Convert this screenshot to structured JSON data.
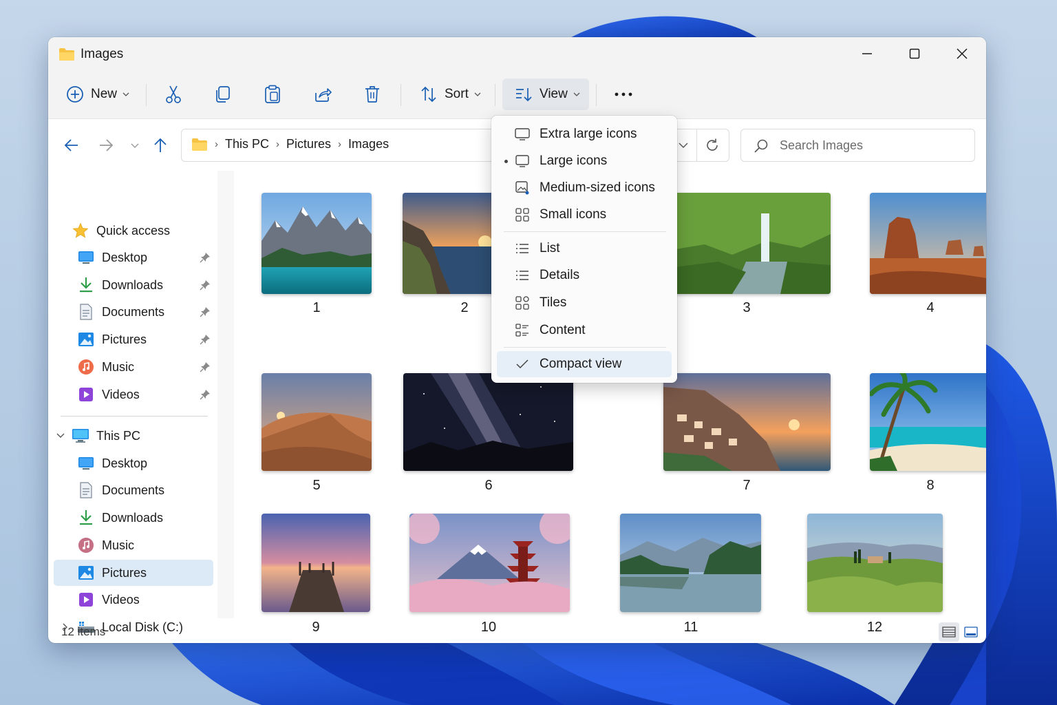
{
  "window": {
    "title": "Images",
    "title_icon": "folder-icon"
  },
  "toolbar": {
    "new_label": "New",
    "sort_label": "Sort",
    "view_label": "View",
    "icons": [
      "cut-icon",
      "copy-icon",
      "paste-icon",
      "share-icon",
      "delete-icon",
      "more-icon"
    ]
  },
  "breadcrumb": [
    "This PC",
    "Pictures",
    "Images"
  ],
  "search": {
    "placeholder": "Search Images"
  },
  "sidebar": {
    "quick_access": {
      "label": "Quick access",
      "items": [
        {
          "label": "Desktop",
          "icon": "desktop-icon"
        },
        {
          "label": "Downloads",
          "icon": "downloads-icon"
        },
        {
          "label": "Documents",
          "icon": "documents-icon"
        },
        {
          "label": "Pictures",
          "icon": "pictures-icon"
        },
        {
          "label": "Music",
          "icon": "music-icon"
        },
        {
          "label": "Videos",
          "icon": "videos-icon"
        }
      ]
    },
    "this_pc": {
      "label": "This PC",
      "items": [
        {
          "label": "Desktop",
          "icon": "desktop-icon"
        },
        {
          "label": "Documents",
          "icon": "documents-icon"
        },
        {
          "label": "Downloads",
          "icon": "downloads-icon"
        },
        {
          "label": "Music",
          "icon": "music-icon"
        },
        {
          "label": "Pictures",
          "icon": "pictures-icon",
          "selected": true
        },
        {
          "label": "Videos",
          "icon": "videos-icon"
        },
        {
          "label": "Local Disk (C:)",
          "icon": "drive-icon"
        }
      ]
    }
  },
  "files": [
    {
      "name": "1"
    },
    {
      "name": "2"
    },
    {
      "name": "3"
    },
    {
      "name": "4"
    },
    {
      "name": "5"
    },
    {
      "name": "6"
    },
    {
      "name": "7"
    },
    {
      "name": "8"
    },
    {
      "name": "9"
    },
    {
      "name": "10"
    },
    {
      "name": "11"
    },
    {
      "name": "12"
    }
  ],
  "view_menu": {
    "items": [
      {
        "label": "Extra large icons",
        "icon": "monitor-icon"
      },
      {
        "label": "Large icons",
        "icon": "monitor-icon",
        "current": true
      },
      {
        "label": "Medium-sized icons",
        "icon": "image-icon"
      },
      {
        "label": "Small icons",
        "icon": "grid-icon"
      },
      {
        "label": "List",
        "icon": "list-icon"
      },
      {
        "label": "Details",
        "icon": "details-icon"
      },
      {
        "label": "Tiles",
        "icon": "tiles-icon"
      },
      {
        "label": "Content",
        "icon": "content-icon"
      },
      {
        "label": "Compact view",
        "icon": "checkmark-icon",
        "checked": true
      }
    ]
  },
  "status": {
    "item_count": "12 items"
  }
}
